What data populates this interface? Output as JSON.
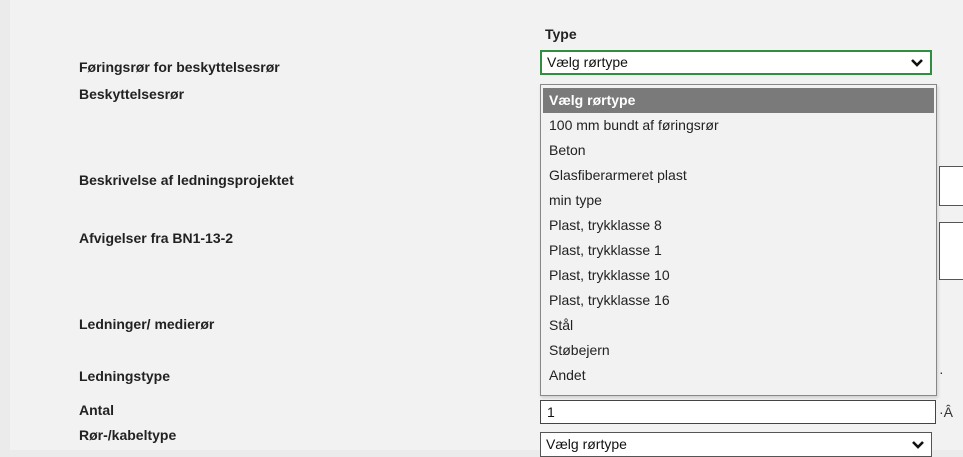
{
  "column_header": "Type",
  "labels": {
    "foringsror": "Føringsrør for beskyttelsesrør",
    "beskyttelsesror": "Beskyttelsesrør",
    "beskrivelse": "Beskrivelse af ledningsprojektet",
    "afvigelser": "Afvigelser fra BN1-13-2",
    "ledninger": "Ledninger/ medierør",
    "ledningstype": "Ledningstype",
    "antal": "Antal",
    "ror_kabeltype": "Rør-/kabeltype"
  },
  "foringsror_select": {
    "value": "Vælg rørtype"
  },
  "dropdown_options": [
    "Vælg rørtype",
    "100 mm bundt af føringsrør",
    "Beton",
    "Glasfiberarmeret plast",
    "min type",
    "Plast, trykklasse 8",
    "Plast, trykklasse 1",
    "Plast, trykklasse 10",
    "Plast, trykklasse 16",
    "Stål",
    "Støbejern",
    "Andet"
  ],
  "antal_input": {
    "value": "1"
  },
  "antal_trailing": "·Â",
  "ledningstype_trailing": "·",
  "ror_kabeltype_select": {
    "value": "Vælg rørtype"
  },
  "colors": {
    "focus_border": "#2f8f3e",
    "selected_option_bg": "#7a7a7a"
  }
}
